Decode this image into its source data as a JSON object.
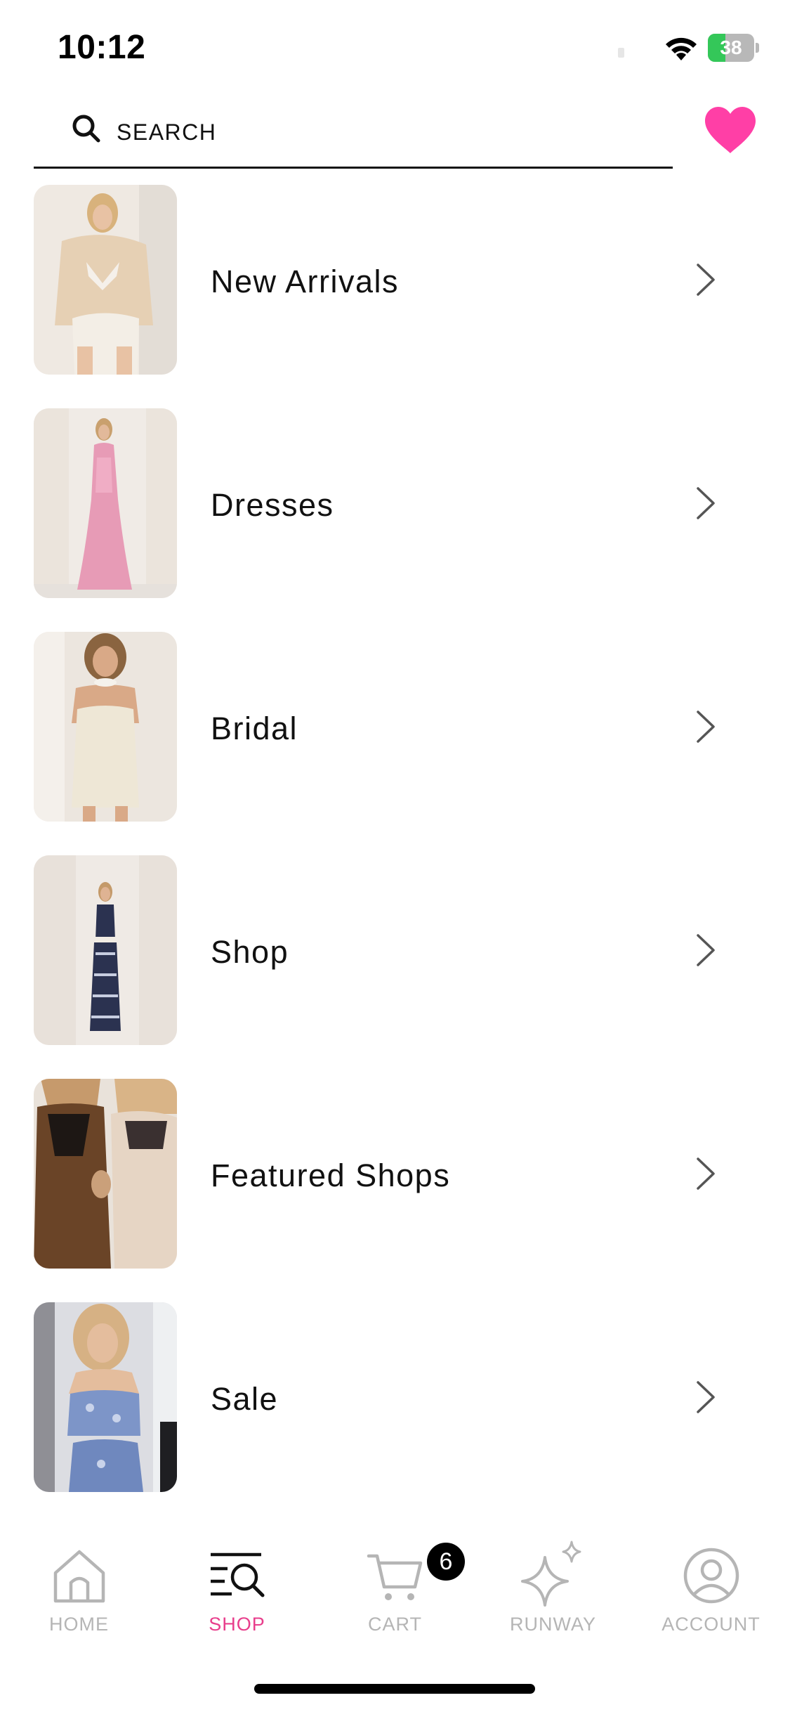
{
  "status_bar": {
    "time": "10:12",
    "battery_level": "38",
    "battery_percent": 38,
    "battery_color": "#34c759"
  },
  "search": {
    "label": "SEARCH",
    "icon": "search-icon"
  },
  "favorites": {
    "icon": "heart-icon",
    "color": "#ff3fa6"
  },
  "categories": [
    {
      "label": "New Arrivals",
      "image": "woman-in-sheer-beige-blouse"
    },
    {
      "label": "Dresses",
      "image": "woman-in-pink-sequin-gown"
    },
    {
      "label": "Bridal",
      "image": "woman-in-white-knit-dress"
    },
    {
      "label": "Shop",
      "image": "woman-in-navy-striped-set"
    },
    {
      "label": "Featured Shops",
      "image": "two-women-in-sequin-slip-dresses"
    },
    {
      "label": "Sale",
      "image": "woman-in-blue-sequin-set"
    }
  ],
  "tab_bar": {
    "accent_color": "#e83e8c",
    "tabs": [
      {
        "label": "HOME",
        "icon": "home-icon",
        "active": false
      },
      {
        "label": "SHOP",
        "icon": "shop-search-icon",
        "active": true
      },
      {
        "label": "CART",
        "icon": "cart-icon",
        "active": false
      },
      {
        "label": "RUNWAY",
        "icon": "sparkle-icon",
        "active": false
      },
      {
        "label": "ACCOUNT",
        "icon": "account-icon",
        "active": false
      }
    ],
    "cart_count": "6"
  }
}
